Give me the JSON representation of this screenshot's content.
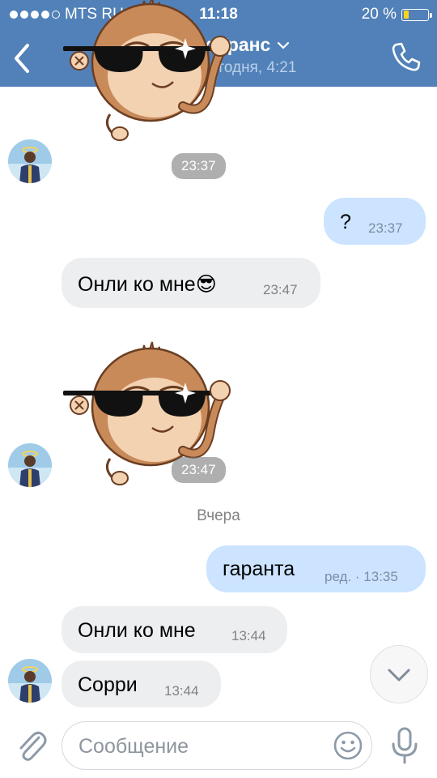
{
  "status_bar": {
    "carrier": "MTS RUS",
    "time": "11:18",
    "battery_percent": "20 %",
    "battery_level": 0.2
  },
  "header": {
    "title": "Генрих Транс",
    "subtitle": "заходил сегодня, 4:21",
    "back_icon": "chevron-left-icon",
    "call_icon": "phone-icon"
  },
  "messages": [
    {
      "kind": "sticker",
      "from": "them",
      "time": "23:37"
    },
    {
      "kind": "text",
      "from": "me",
      "text": "?",
      "time": "23:37"
    },
    {
      "kind": "text",
      "from": "them",
      "text": "Онли ко мне😎",
      "time": "23:47"
    },
    {
      "kind": "sticker",
      "from": "them",
      "time": "23:47"
    },
    {
      "kind": "date",
      "text": "Вчера"
    },
    {
      "kind": "text",
      "from": "me",
      "text": "гаранта",
      "time": "ред. · 13:35"
    },
    {
      "kind": "text",
      "from": "them",
      "text": "Онли ко мне",
      "time": "13:44"
    },
    {
      "kind": "text",
      "from": "them",
      "text": "Сорри",
      "time": "13:44"
    }
  ],
  "composer": {
    "placeholder": "Сообщение",
    "attach_icon": "paperclip-icon",
    "emoji_icon": "smiley-icon",
    "mic_icon": "microphone-icon"
  },
  "colors": {
    "header_bg": "#5181b8",
    "incoming_bubble": "#edeef0",
    "outgoing_bubble": "#cce4ff",
    "battery_fill": "#f5d323"
  }
}
